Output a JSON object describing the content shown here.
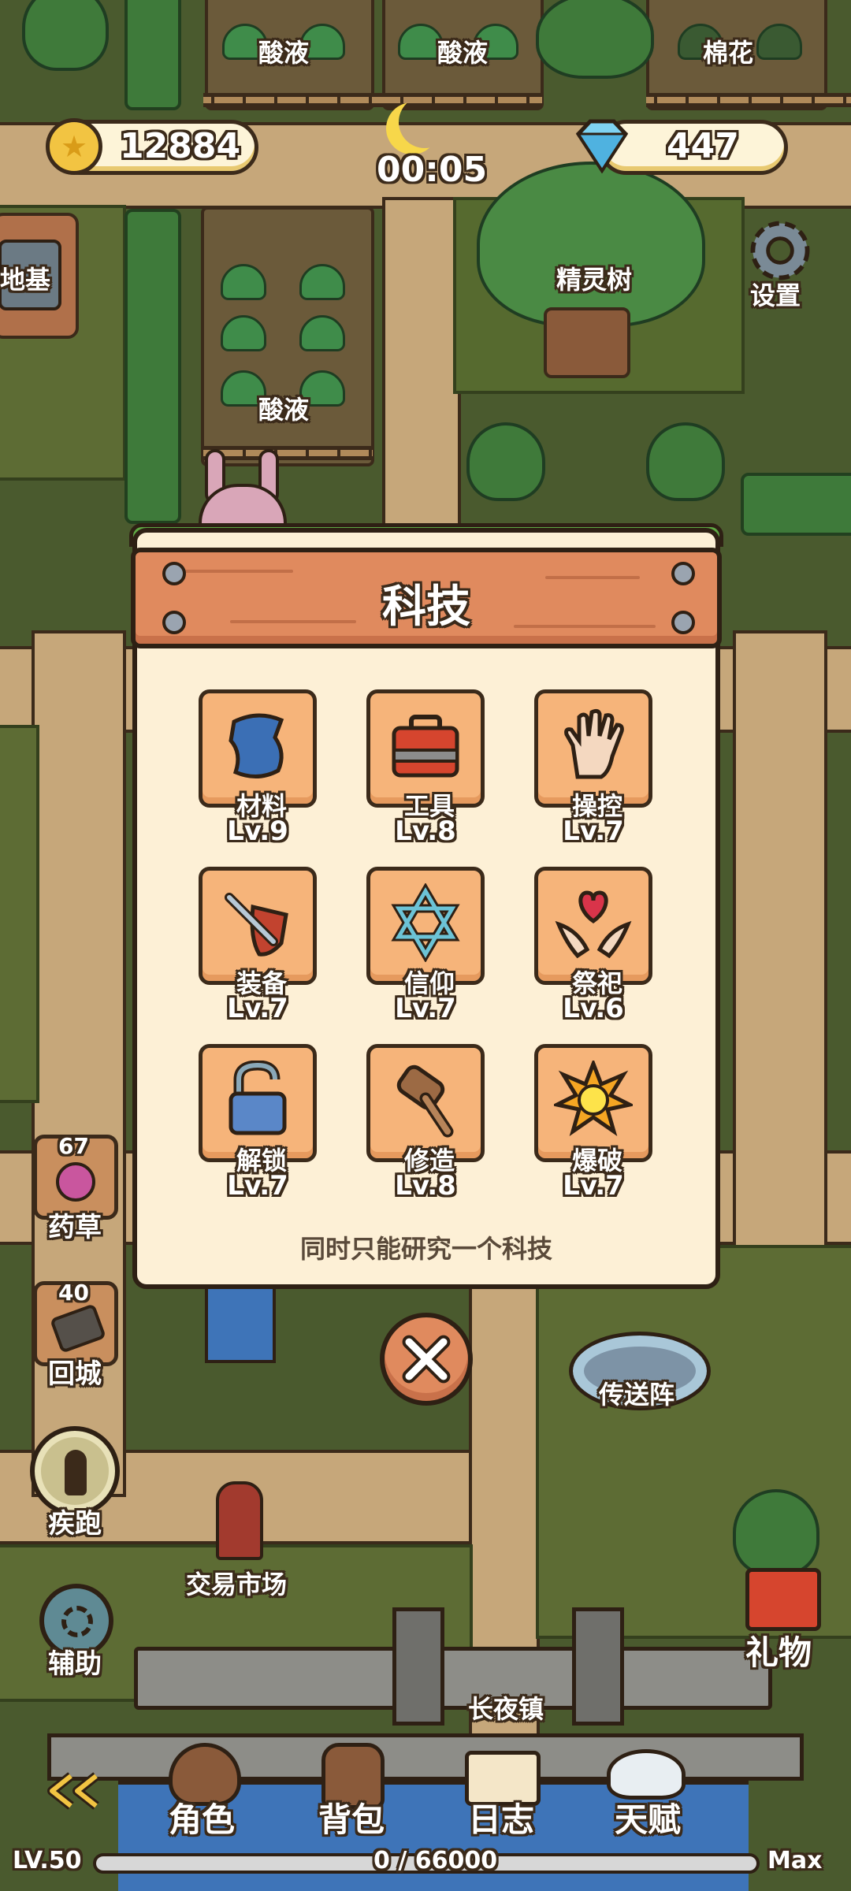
{
  "hud": {
    "coins": "12884",
    "gems": "447",
    "clock": "00:05"
  },
  "map_labels": {
    "acid_1": "酸液",
    "acid_2": "酸液",
    "acid_3": "酸液",
    "cotton": "棉花",
    "foundation": "地基",
    "spirit_tree": "精灵树",
    "settings": "设置",
    "teleport": "传送阵",
    "market": "交易市场",
    "town": "长夜镇",
    "gift": "礼物"
  },
  "side_buttons": [
    {
      "label": "药草",
      "count": "67"
    },
    {
      "label": "回城",
      "count": "40"
    },
    {
      "label": "疾跑"
    },
    {
      "label": "辅助"
    }
  ],
  "modal": {
    "title": "科技",
    "note": "同时只能研究一个科技",
    "techs": [
      {
        "name": "材料",
        "level": "Lv.9",
        "icon": "cloth-material-icon"
      },
      {
        "name": "工具",
        "level": "Lv.8",
        "icon": "toolbox-icon"
      },
      {
        "name": "操控",
        "level": "Lv.7",
        "icon": "hand-icon"
      },
      {
        "name": "装备",
        "level": "Lv.7",
        "icon": "sword-shield-icon"
      },
      {
        "name": "信仰",
        "level": "Lv.7",
        "icon": "hexagram-icon"
      },
      {
        "name": "祭祀",
        "level": "Lv.6",
        "icon": "heart-offering-icon"
      },
      {
        "name": "解锁",
        "level": "Lv.7",
        "icon": "padlock-icon"
      },
      {
        "name": "修造",
        "level": "Lv.8",
        "icon": "mallet-icon"
      },
      {
        "name": "爆破",
        "level": "Lv.7",
        "icon": "explosion-icon"
      }
    ]
  },
  "bottom_nav": [
    {
      "label": "角色",
      "icon": "character-icon"
    },
    {
      "label": "背包",
      "icon": "backpack-icon"
    },
    {
      "label": "日志",
      "icon": "journal-icon"
    },
    {
      "label": "天赋",
      "icon": "talent-wings-icon"
    }
  ],
  "level": {
    "label": "LV.50",
    "xp": "0 / 66000",
    "max_label": "Max"
  }
}
